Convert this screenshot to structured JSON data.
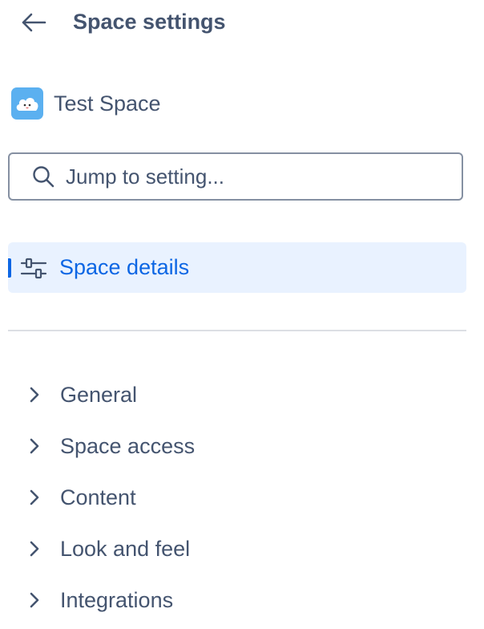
{
  "header": {
    "back_icon": "arrow-left-icon",
    "title": "Space settings"
  },
  "space": {
    "avatar_icon": "cloud-avatar-icon",
    "avatar_color": "#5bb0f0",
    "name": "Test Space"
  },
  "search": {
    "icon": "search-icon",
    "placeholder": "Jump to setting...",
    "value": ""
  },
  "nav": {
    "active_item": {
      "icon": "sliders-icon",
      "label": "Space details",
      "accent_color": "#0c66e4",
      "background_color": "#e9f2ff"
    },
    "groups": [
      {
        "label": "General",
        "icon": "chevron-right-icon",
        "expanded": false
      },
      {
        "label": "Space access",
        "icon": "chevron-right-icon",
        "expanded": false
      },
      {
        "label": "Content",
        "icon": "chevron-right-icon",
        "expanded": false
      },
      {
        "label": "Look and feel",
        "icon": "chevron-right-icon",
        "expanded": false
      },
      {
        "label": "Integrations",
        "icon": "chevron-right-icon",
        "expanded": false
      }
    ]
  },
  "colors": {
    "text": "#44546f",
    "border": "#8590a2",
    "divider": "#dcdfe4"
  }
}
